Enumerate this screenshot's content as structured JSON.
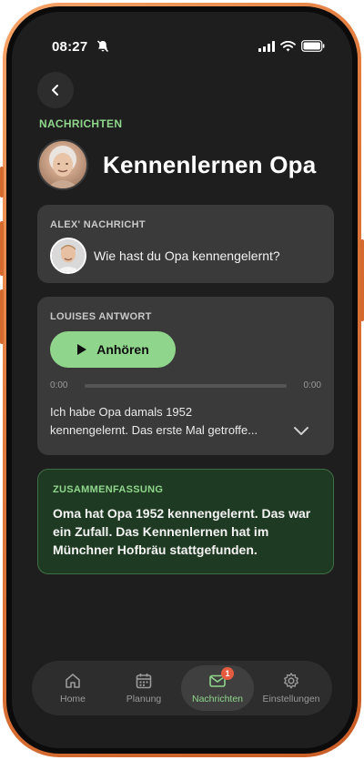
{
  "status_bar": {
    "time": "08:27",
    "icons": [
      "bell-muted-icon",
      "signal-icon",
      "wifi-icon",
      "battery-icon"
    ]
  },
  "header": {
    "section_label": "NACHRICHTEN",
    "title": "Kennenlernen Opa"
  },
  "message_card": {
    "label": "ALEX' NACHRICHT",
    "text": "Wie hast du Opa kennengelernt?"
  },
  "answer_card": {
    "label": "LOUISES ANTWORT",
    "play_label": "Anhören",
    "current_time": "0:00",
    "total_time": "0:00",
    "progress": 0,
    "transcript_line1": "Ich habe Opa damals 1952",
    "transcript_line2": "kennengelernt. Das erste Mal getroffe..."
  },
  "summary_card": {
    "label": "ZUSAMMENFASSUNG",
    "text": "Oma hat Opa 1952 kennengelernt. Das war ein Zufall. Das Kennenlernen hat im Münchner Hofbräu stattgefunden."
  },
  "tabbar": {
    "items": [
      {
        "label": "Home",
        "icon": "home-icon"
      },
      {
        "label": "Planung",
        "icon": "calendar-icon"
      },
      {
        "label": "Nachrichten",
        "icon": "mail-icon",
        "badge": "1",
        "active": true
      },
      {
        "label": "Einstellungen",
        "icon": "gear-icon"
      }
    ]
  },
  "colors": {
    "accent": "#8fd68c",
    "background": "#1e1e1e",
    "card": "#3a3a3a",
    "summary_bg": "#1f3a22",
    "badge": "#e45b3f",
    "frame": "#e0793c"
  }
}
